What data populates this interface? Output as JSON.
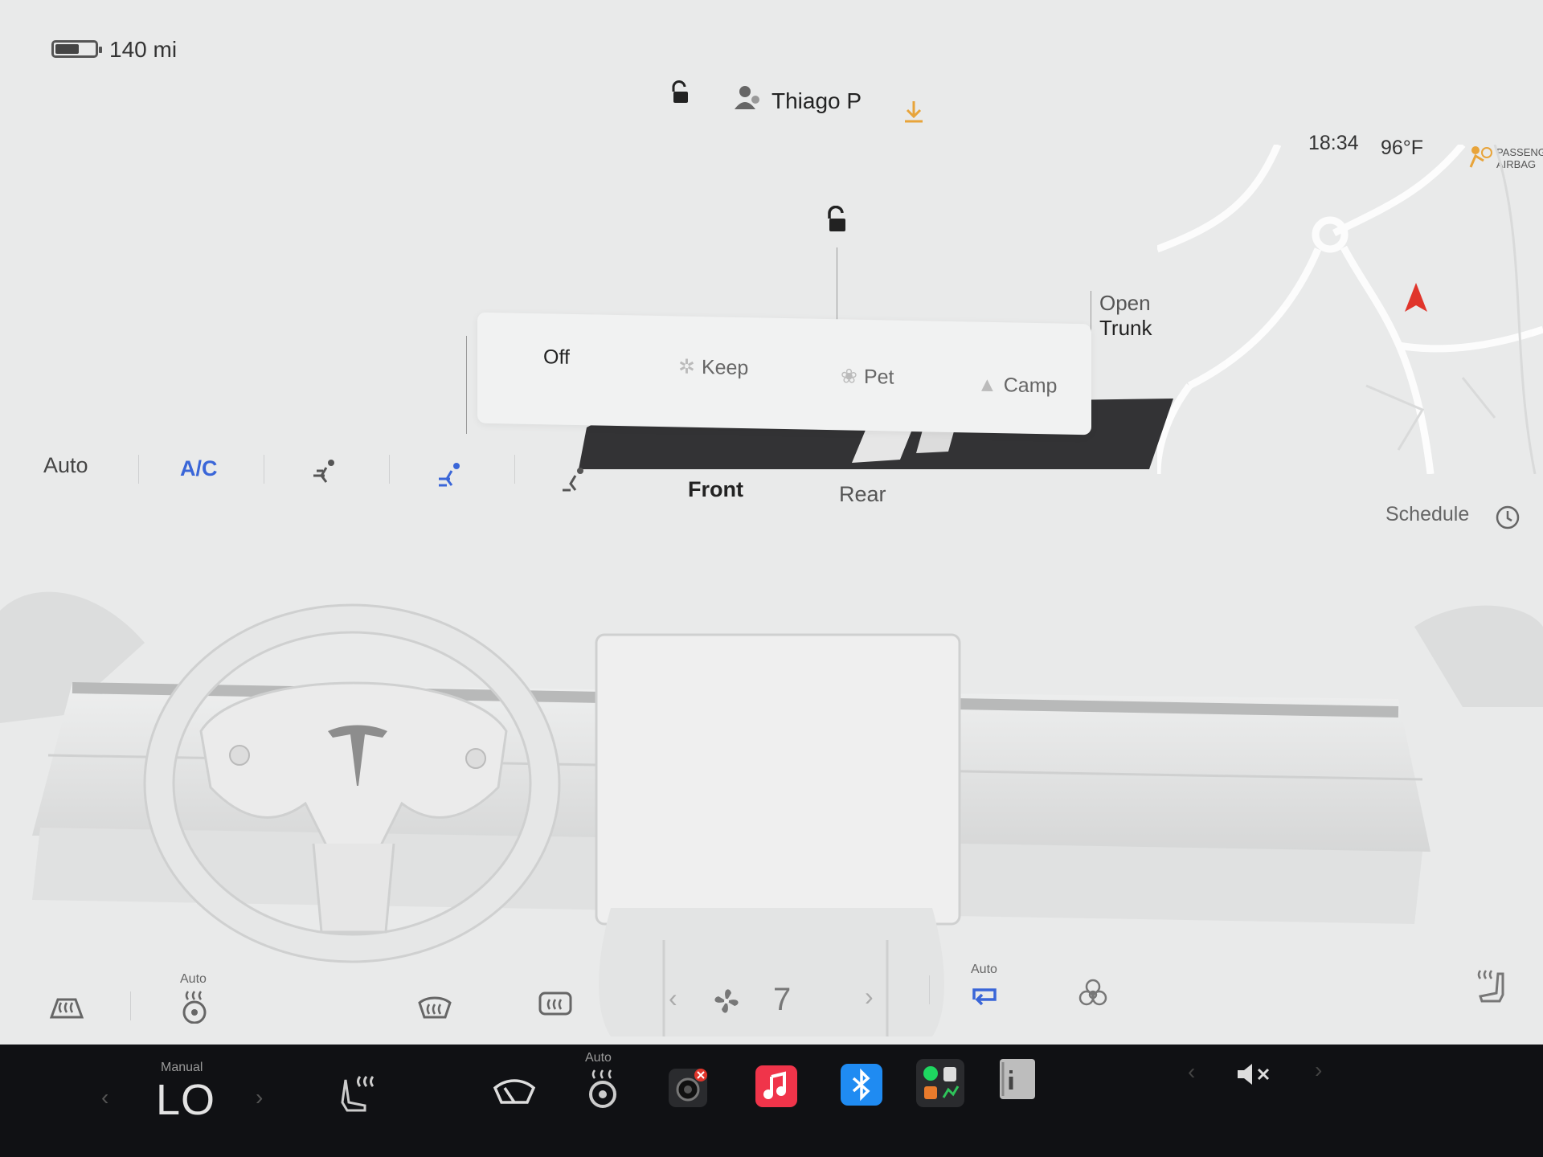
{
  "status": {
    "range": "140 mi",
    "battery_level": 0.6,
    "profile_name": "Thiago P",
    "time": "18:34",
    "outside_temp": "96°F",
    "airbag_line1": "PASSENGE",
    "airbag_line2": "AIRBAG"
  },
  "car": {
    "open_trunk_line1": "Open",
    "open_trunk_line2": "Trunk"
  },
  "climate_keeper": {
    "options": [
      "Off",
      "Keep",
      "Pet",
      "Camp"
    ],
    "selected": "Off"
  },
  "climate": {
    "auto_label": "Auto",
    "ac_label": "A/C",
    "front_label": "Front",
    "rear_label": "Rear",
    "schedule_label": "Schedule",
    "seat_heat_auto_label": "Auto",
    "recirc_auto_label": "Auto",
    "fan_speed": "7"
  },
  "taskbar": {
    "mode_label": "Manual",
    "temperature": "LO",
    "wheel_heat_auto_label": "Auto"
  },
  "colors": {
    "accent": "#3a66d8",
    "download": "#e8a43a",
    "nav_arrow": "#e0352b",
    "music": "#f0344a",
    "bluetooth": "#1f8bf2"
  },
  "icons": [
    "battery-icon",
    "lock-icon",
    "profile-icon",
    "download-icon",
    "airbag-icon",
    "nav-arrow-icon",
    "vent-icon",
    "clock-icon",
    "rear-defrost-icon",
    "seat-heat-icon",
    "windshield-defrost-icon",
    "fan-icon",
    "recirculate-icon",
    "bioweapon-icon",
    "seat-heat-passenger-icon",
    "wiper-icon",
    "steering-wheel-heat-icon",
    "camera-icon",
    "music-icon",
    "bluetooth-icon",
    "apps-icon",
    "manual-icon",
    "mute-icon"
  ]
}
